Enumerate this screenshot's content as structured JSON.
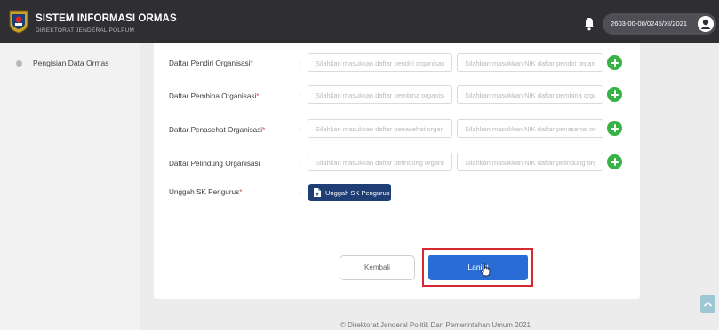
{
  "header": {
    "title": "SISTEM INFORMASI ORMAS",
    "subtitle": "DIREKTORAT JENDERAL POLPUM",
    "user_id": "2603-00-00/0245/XI/2021"
  },
  "sidebar": {
    "items": [
      {
        "label": "Pengisian Data Ormas"
      }
    ]
  },
  "form": {
    "rows": [
      {
        "label": "Daftar Pendiri Organisasi",
        "required": "*",
        "name_placeholder": "Silahkan masukkan daftar pendiri organisasi",
        "nik_placeholder": "Silahkan masukkan NIK daftar pendiri organisasi"
      },
      {
        "label": "Daftar Pembina Organisasi",
        "required": "*",
        "name_placeholder": "Silahkan masukkan daftar pembina organisasi",
        "nik_placeholder": "Silahkan masukkan NIK daftar pembina organisasi"
      },
      {
        "label": "Daftar Penasehat Organisasi",
        "required": "*",
        "name_placeholder": "Silahkan masukkan daftar penasehat organisasi",
        "nik_placeholder": "Silahkan masukkan NIK daftar penasehat organisasi"
      },
      {
        "label": "Daftar Pelindung Organisasi",
        "required": "",
        "name_placeholder": "Silahkan masukkan daftar pelindung organisasi",
        "nik_placeholder": "Silahkan masukkan NIK daftar pelindung organisasi"
      }
    ],
    "upload": {
      "label": "Unggah SK Pengurus",
      "required": "*",
      "button_label": "Unggah SK Pengurus"
    },
    "colon": ":",
    "back_label": "Kembali",
    "next_label": "Lanjut"
  },
  "footer": {
    "text": "© Direktorat Jenderal Politik Dan Pemerintahan Umum 2021"
  },
  "icons": [
    "garuda-logo-icon",
    "bell-icon",
    "user-avatar-icon",
    "add-icon",
    "file-upload-icon",
    "hand-cursor-icon",
    "chevron-up-icon"
  ],
  "colors": {
    "header_bg": "#2e2e33",
    "add_green": "#38b247",
    "primary_blue": "#2a6cd6",
    "upload_navy": "#1e3e75",
    "highlight_red": "#d6282e"
  }
}
